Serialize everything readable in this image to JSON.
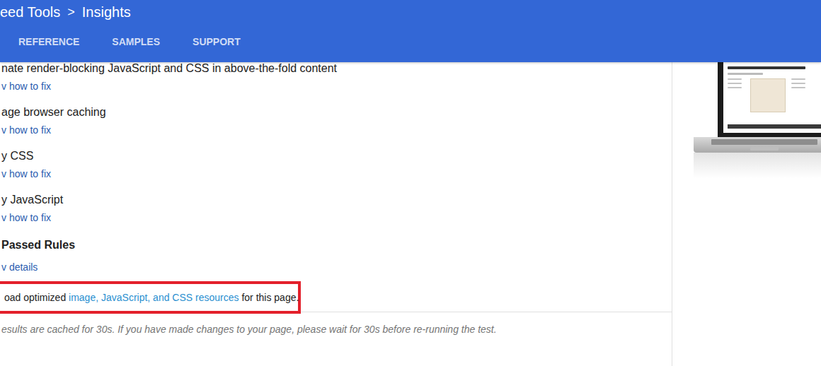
{
  "header": {
    "product": "eed Tools",
    "separator": ">",
    "page": "Insights"
  },
  "tabs": [
    {
      "label": "REFERENCE",
      "selected": false
    },
    {
      "label": "SAMPLES",
      "selected": false
    },
    {
      "label": "SUPPORT",
      "selected": false
    }
  ],
  "rules": [
    {
      "title": "nate render-blocking JavaScript and CSS in above-the-fold content",
      "link": "v how to fix"
    },
    {
      "title": "age browser caching",
      "link": "v how to fix"
    },
    {
      "title": "y CSS",
      "link": "v how to fix"
    },
    {
      "title": "y JavaScript",
      "link": "v how to fix"
    }
  ],
  "passed": {
    "title": "Passed Rules",
    "link": "v details"
  },
  "highlight": [
    {
      "text": "oad optimized ",
      "kind": "text"
    },
    {
      "text": "image, JavaScript, and CSS resources",
      "kind": "link"
    },
    {
      "text": " for this page.",
      "kind": "text"
    }
  ],
  "note": "esults are cached for 30s. If you have made changes to your page, please wait for 30s before re-running the test."
}
